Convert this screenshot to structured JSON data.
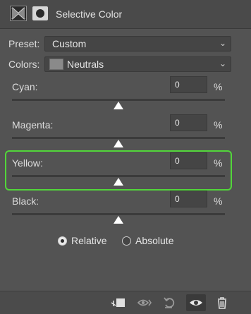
{
  "header": {
    "title": "Selective Color",
    "adjustment_icon": "selective-color-adjustment-icon",
    "mask_icon": "layer-mask-icon"
  },
  "preset": {
    "label": "Preset:",
    "value": "Custom"
  },
  "colors": {
    "label": "Colors:",
    "value": "Neutrals",
    "swatch_color": "#8a8a8a"
  },
  "sliders": [
    {
      "label": "Cyan:",
      "value": "0",
      "unit": "%",
      "level": 0.5
    },
    {
      "label": "Magenta:",
      "value": "0",
      "unit": "%",
      "level": 0.5
    },
    {
      "label": "Yellow:",
      "value": "0",
      "unit": "%",
      "level": 0.5,
      "highlighted": true
    },
    {
      "label": "Black:",
      "value": "0",
      "unit": "%",
      "level": 0.5
    }
  ],
  "method": {
    "options": [
      "Relative",
      "Absolute"
    ],
    "selected": "Relative"
  },
  "footer_icons": [
    "clip-to-layer-icon",
    "view-previous-state-icon",
    "reset-icon",
    "visibility-eye-icon",
    "trash-icon"
  ],
  "colors_theme": {
    "panel": "#535353",
    "highlight": "#52d63a"
  }
}
